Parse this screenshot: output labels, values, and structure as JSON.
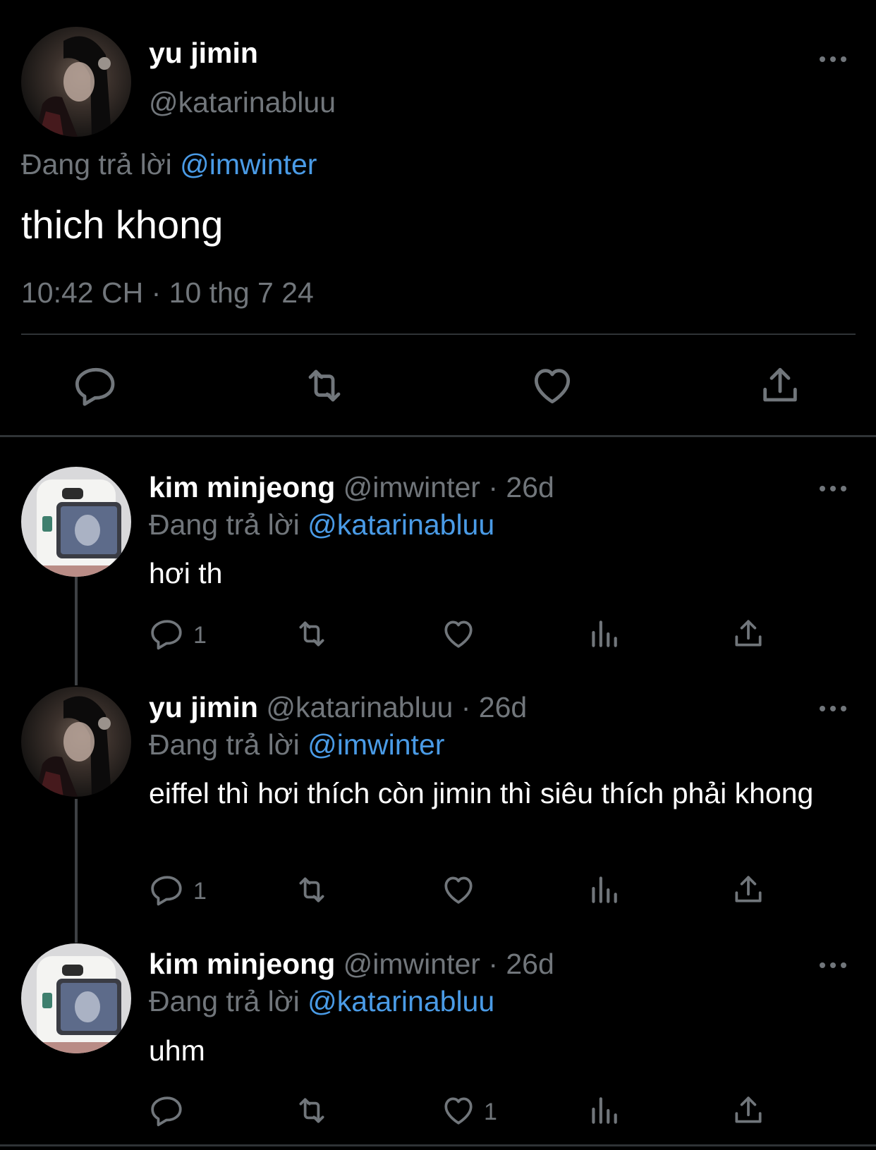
{
  "main_tweet": {
    "name": "yu jimin",
    "handle": "@katarinabluu",
    "replying_prefix": "Đang trả lời",
    "replying_to": "@imwinter",
    "text": "thich khong",
    "timestamp": "10:42 CH · 10 thg 7 24"
  },
  "replies": [
    {
      "name": "kim minjeong",
      "handle": "@imwinter",
      "age": "· 26d",
      "replying_prefix": "Đang trả lời",
      "replying_to": "@katarinabluu",
      "text": "hơi th",
      "reply_count": "1",
      "like_count": ""
    },
    {
      "name": "yu jimin",
      "handle": "@katarinabluu",
      "age": "· 26d",
      "replying_prefix": "Đang trả lời",
      "replying_to": "@imwinter",
      "text": "eiffel thì hơi thích còn jimin thì siêu thích phải khong",
      "reply_count": "1",
      "like_count": ""
    },
    {
      "name": "kim minjeong",
      "handle": "@imwinter",
      "age": "· 26d",
      "replying_prefix": "Đang trả lời",
      "replying_to": "@katarinabluu",
      "text": "uhm",
      "reply_count": "",
      "like_count": "1"
    }
  ],
  "colors": {
    "background": "#000000",
    "text_primary": "#e7e9ea",
    "text_secondary": "#71767b",
    "link": "#4a9be6",
    "divider": "#2f3336"
  },
  "icons": [
    "reply-icon",
    "retweet-icon",
    "like-icon",
    "share-icon",
    "views-icon",
    "more-icon"
  ]
}
